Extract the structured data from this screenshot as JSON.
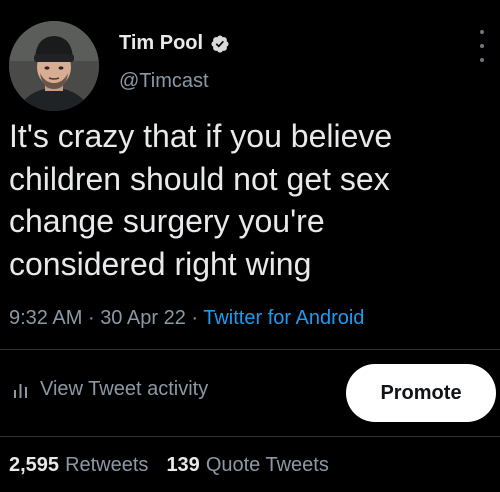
{
  "author": {
    "display_name": "Tim Pool",
    "handle": "@Timcast",
    "verified": true
  },
  "tweet": {
    "text": "It's crazy that if you believe\nchildren should not get sex\nchange surgery you're\nconsidered right wing",
    "time": "9:32 AM",
    "separator": "·",
    "date": "30 Apr 22",
    "source": "Twitter for Android"
  },
  "actions": {
    "activity_label": "View Tweet activity",
    "promote_label": "Promote"
  },
  "stats": {
    "retweets_count": "2,595",
    "retweets_label": "Retweets",
    "quotes_count": "139",
    "quotes_label": "Quote Tweets"
  },
  "colors": {
    "background": "#000000",
    "primary_text": "#e7e9ea",
    "secondary_text": "#8b98a5",
    "link": "#1d9bf0",
    "verified_badge": "#d9d9d9",
    "divider": "#2f3336"
  },
  "icons": {
    "verified": "verified-badge-icon",
    "more": "more-options-icon",
    "activity": "bar-chart-icon"
  }
}
